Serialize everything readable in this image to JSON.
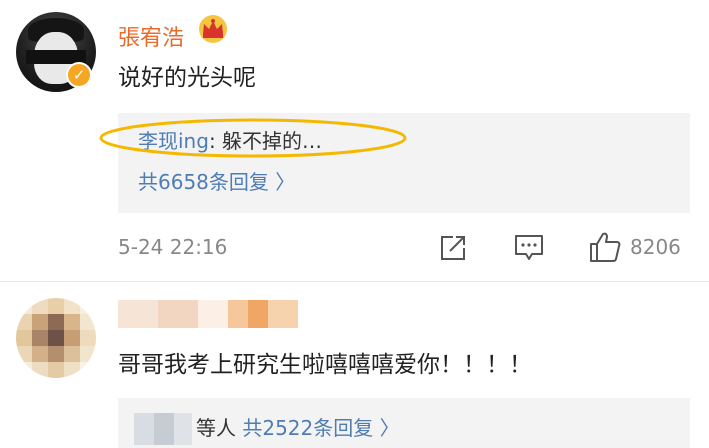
{
  "comments": [
    {
      "username": "張宥浩",
      "badge": "crown-icon",
      "verified": true,
      "text": "说好的光头呢",
      "reply_preview": {
        "name": "李现ing",
        "separator": ": ",
        "text": "躲不掉的…"
      },
      "reply_more": "共6658条回复 〉",
      "timestamp": "5-24 22:16",
      "like_count": "8206"
    },
    {
      "username": "",
      "text": "哥哥我考上研究生啦嘻嘻嘻爱你！！！！",
      "reply_suffix": "等人",
      "reply_count": "共2522条回复 〉"
    }
  ],
  "colors": {
    "username": "#e86b2c",
    "link": "#4f7db3",
    "meta": "#888888",
    "highlight": "#f5b800",
    "reply_bg": "#f3f3f3"
  },
  "icons": [
    "share-icon",
    "comment-icon",
    "like-icon",
    "verified-icon",
    "crown-icon"
  ]
}
